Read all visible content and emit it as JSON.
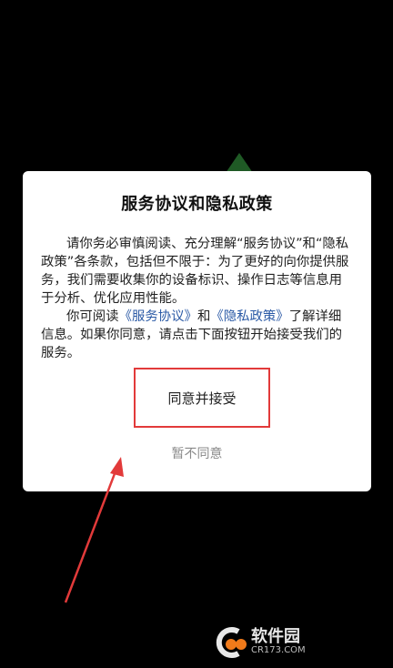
{
  "dialog": {
    "title": "服务协议和隐私政策",
    "para1": "请你务必审慎阅读、充分理解“服务协议”和“隐私政策”各条款，包括但不限于：为了更好的向你提供服务，我们需要收集你的设备标识、操作日志等信息用于分析、优化应用性能。",
    "para2_prefix": "你可阅读",
    "link_service": "《服务协议》",
    "para2_and": "和",
    "link_privacy": "《隐私政策》",
    "para2_suffix": "了解详细信息。如果你同意，请点击下面按钮开始接受我们的服务。",
    "agree_label": "同意并接受",
    "decline_label": "暂不同意"
  },
  "watermark": {
    "brand_text": "软件园",
    "site_text": "CR173.COM"
  },
  "colors": {
    "background": "#000000",
    "dialog_bg": "#ffffff",
    "link": "#2b5aa6",
    "highlight_red": "#e23a3a",
    "decline_text": "#8a8a8a"
  },
  "icons": [
    "red-arrow-annotation-icon",
    "highlight-box-annotation",
    "cr173-logo-icon"
  ]
}
